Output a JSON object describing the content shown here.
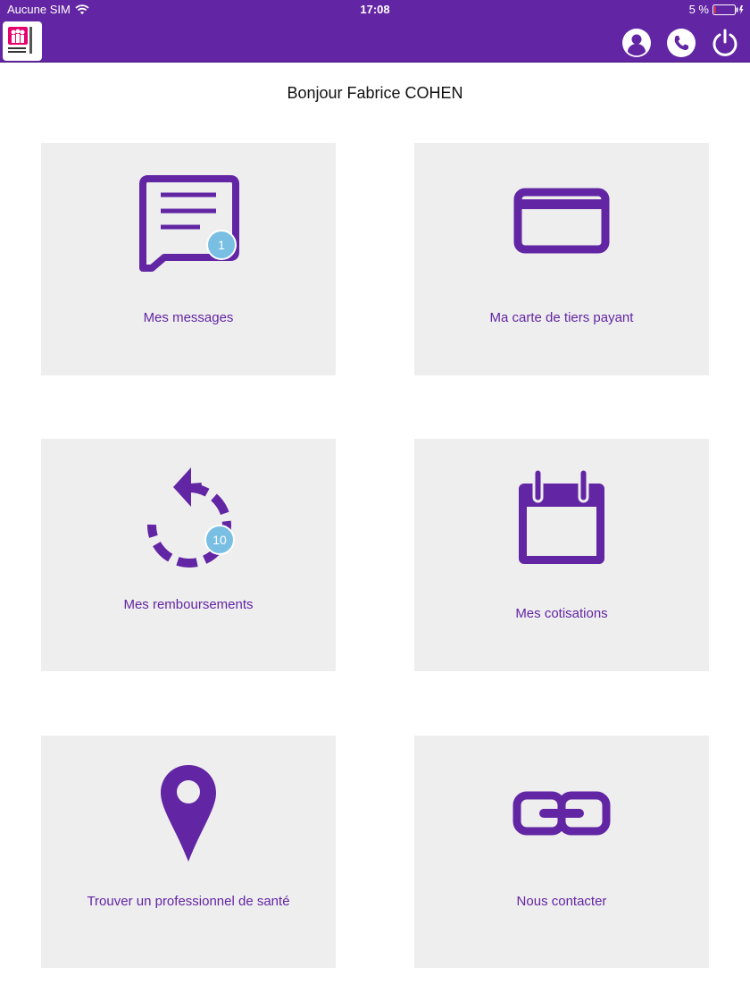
{
  "status_bar": {
    "carrier": "Aucune SIM",
    "time": "17:08",
    "battery_percent": "5 %",
    "battery_level": 0.05
  },
  "header": {
    "logo_icon": "mutuelle-logo-icon",
    "actions": [
      {
        "icon": "profile-icon"
      },
      {
        "icon": "phone-icon"
      },
      {
        "icon": "power-icon"
      }
    ]
  },
  "greeting": "Bonjour Fabrice COHEN",
  "tiles": [
    {
      "label": "Mes messages",
      "icon": "message-icon",
      "badge": "1"
    },
    {
      "label": "Ma carte de tiers payant",
      "icon": "card-icon"
    },
    {
      "label": "Mes remboursements",
      "icon": "refund-icon",
      "badge": "10"
    },
    {
      "label": "Mes cotisations",
      "icon": "calendar-icon"
    },
    {
      "label": "Trouver un professionnel de santé",
      "icon": "map-pin-icon"
    },
    {
      "label": "Nous contacter",
      "icon": "link-icon"
    }
  ],
  "colors": {
    "brand": "#6225a3",
    "tile_bg": "#eeeeef",
    "badge": "#79bfe3"
  }
}
